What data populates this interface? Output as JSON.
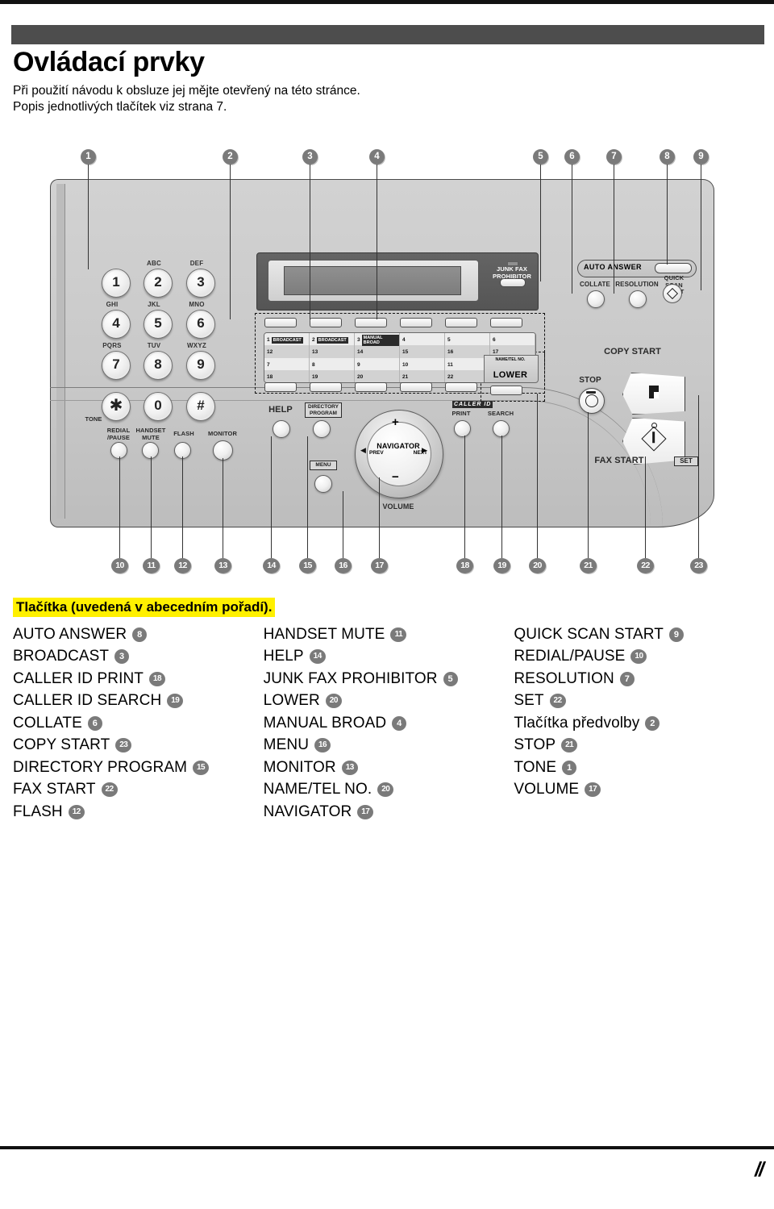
{
  "page": {
    "title": "Ovládací prvky",
    "intro_line1": "Při použití návodu k obsluze jej mějte otevřený na této stránce.",
    "intro_line2": "Popis jednotlivých tlačítek viz strana 7.",
    "page_mark": "//",
    "banner_color": "#4d4d4d",
    "highlight_color": "#fff000",
    "callout_color": "#7a7a7a"
  },
  "callouts_top": [
    "1",
    "2",
    "3",
    "4",
    "5",
    "6",
    "7",
    "8",
    "9"
  ],
  "callouts_bottom": [
    "10",
    "11",
    "12",
    "13",
    "14",
    "15",
    "16",
    "17",
    "18",
    "19",
    "20",
    "21",
    "22",
    "23"
  ],
  "panel": {
    "keypad": [
      {
        "digit": "1",
        "letters": ""
      },
      {
        "digit": "2",
        "letters": "ABC"
      },
      {
        "digit": "3",
        "letters": "DEF"
      },
      {
        "digit": "4",
        "letters": "GHI"
      },
      {
        "digit": "5",
        "letters": "JKL"
      },
      {
        "digit": "6",
        "letters": "MNO"
      },
      {
        "digit": "7",
        "letters": "PQRS"
      },
      {
        "digit": "8",
        "letters": "TUV"
      },
      {
        "digit": "9",
        "letters": "WXYZ"
      },
      {
        "digit": "✱",
        "letters": ""
      },
      {
        "digit": "0",
        "letters": ""
      },
      {
        "digit": "#",
        "letters": ""
      }
    ],
    "tone_label": "TONE",
    "function_row": [
      "REDIAL\n/PAUSE",
      "HANDSET\nMUTE",
      "FLASH",
      "MONITOR"
    ],
    "redial_label_line1": "REDIAL",
    "redial_label_line2": "/PAUSE",
    "handset_label_line1": "HANDSET",
    "handset_label_line2": "MUTE",
    "flash_label": "FLASH",
    "monitor_label": "MONITOR",
    "junk_fax_line1": "JUNK FAX",
    "junk_fax_line2": "PROHIBITOR",
    "help_label": "HELP",
    "directory_line1": "DIRECTORY",
    "directory_line2": "PROGRAM",
    "menu_label": "MENU",
    "navigator_label": "NAVIGATOR",
    "navigator_prev": "PREV",
    "navigator_next": "NEXT",
    "navigator_plus": "+",
    "navigator_minus": "−",
    "volume_label": "VOLUME",
    "caller_id_label": "CALLER ID",
    "caller_print": "PRINT",
    "caller_search": "SEARCH",
    "auto_answer_label": "AUTO ANSWER",
    "collate_label": "COLLATE",
    "resolution_label": "RESOLUTION",
    "quick_scan_line1": "QUICK SCAN",
    "quick_scan_line2": "START",
    "copy_start_label": "COPY START",
    "stop_label": "STOP",
    "fax_start_label": "FAX START",
    "set_label": "SET",
    "station_grid": {
      "row1": [
        {
          "num": "1",
          "tag": "BROADCAST"
        },
        {
          "num": "2",
          "tag": "BROADCAST"
        },
        {
          "num": "3",
          "tag": "MANUAL BROAD"
        },
        {
          "num": "4",
          "tag": ""
        },
        {
          "num": "5",
          "tag": ""
        },
        {
          "num": "6",
          "tag": ""
        }
      ],
      "row2": [
        {
          "num": "12"
        },
        {
          "num": "13"
        },
        {
          "num": "14"
        },
        {
          "num": "15"
        },
        {
          "num": "16"
        },
        {
          "num": "17"
        }
      ],
      "row3": [
        {
          "num": "7"
        },
        {
          "num": "8"
        },
        {
          "num": "9"
        },
        {
          "num": "10"
        },
        {
          "num": "11"
        },
        {
          "num": ""
        }
      ],
      "row4": [
        {
          "num": "18"
        },
        {
          "num": "19"
        },
        {
          "num": "20"
        },
        {
          "num": "21"
        },
        {
          "num": "22"
        },
        {
          "num": ""
        }
      ],
      "lower_label": "LOWER",
      "name_tel_label": "NAME/TEL NO."
    }
  },
  "legend": {
    "heading": "Tlačítka (uvedená v abecedním pořadí).",
    "col1": [
      {
        "label": "AUTO ANSWER",
        "num": "8"
      },
      {
        "label": "BROADCAST",
        "num": "3"
      },
      {
        "label": "CALLER ID PRINT",
        "num": "18"
      },
      {
        "label": "CALLER ID SEARCH",
        "num": "19"
      },
      {
        "label": "COLLATE",
        "num": "6"
      },
      {
        "label": "COPY START",
        "num": "23"
      },
      {
        "label": "DIRECTORY PROGRAM",
        "num": "15"
      },
      {
        "label": "FAX START",
        "num": "22"
      },
      {
        "label": "FLASH",
        "num": "12"
      }
    ],
    "col2": [
      {
        "label": "HANDSET MUTE",
        "num": "11"
      },
      {
        "label": "HELP",
        "num": "14"
      },
      {
        "label": "JUNK FAX PROHIBITOR",
        "num": "5"
      },
      {
        "label": "LOWER",
        "num": "20"
      },
      {
        "label": "MANUAL BROAD",
        "num": "4"
      },
      {
        "label": "MENU",
        "num": "16"
      },
      {
        "label": "MONITOR",
        "num": "13"
      },
      {
        "label": "NAME/TEL NO.",
        "num": "20"
      },
      {
        "label": "NAVIGATOR",
        "num": "17"
      }
    ],
    "col3": [
      {
        "label": "QUICK SCAN START",
        "num": "9"
      },
      {
        "label": "REDIAL/PAUSE",
        "num": "10"
      },
      {
        "label": "RESOLUTION",
        "num": "7"
      },
      {
        "label": "SET",
        "num": "22"
      },
      {
        "label": "Tlačítka předvolby",
        "num": "2"
      },
      {
        "label": "STOP",
        "num": "21"
      },
      {
        "label": "TONE",
        "num": "1"
      },
      {
        "label": "VOLUME",
        "num": "17"
      }
    ]
  }
}
